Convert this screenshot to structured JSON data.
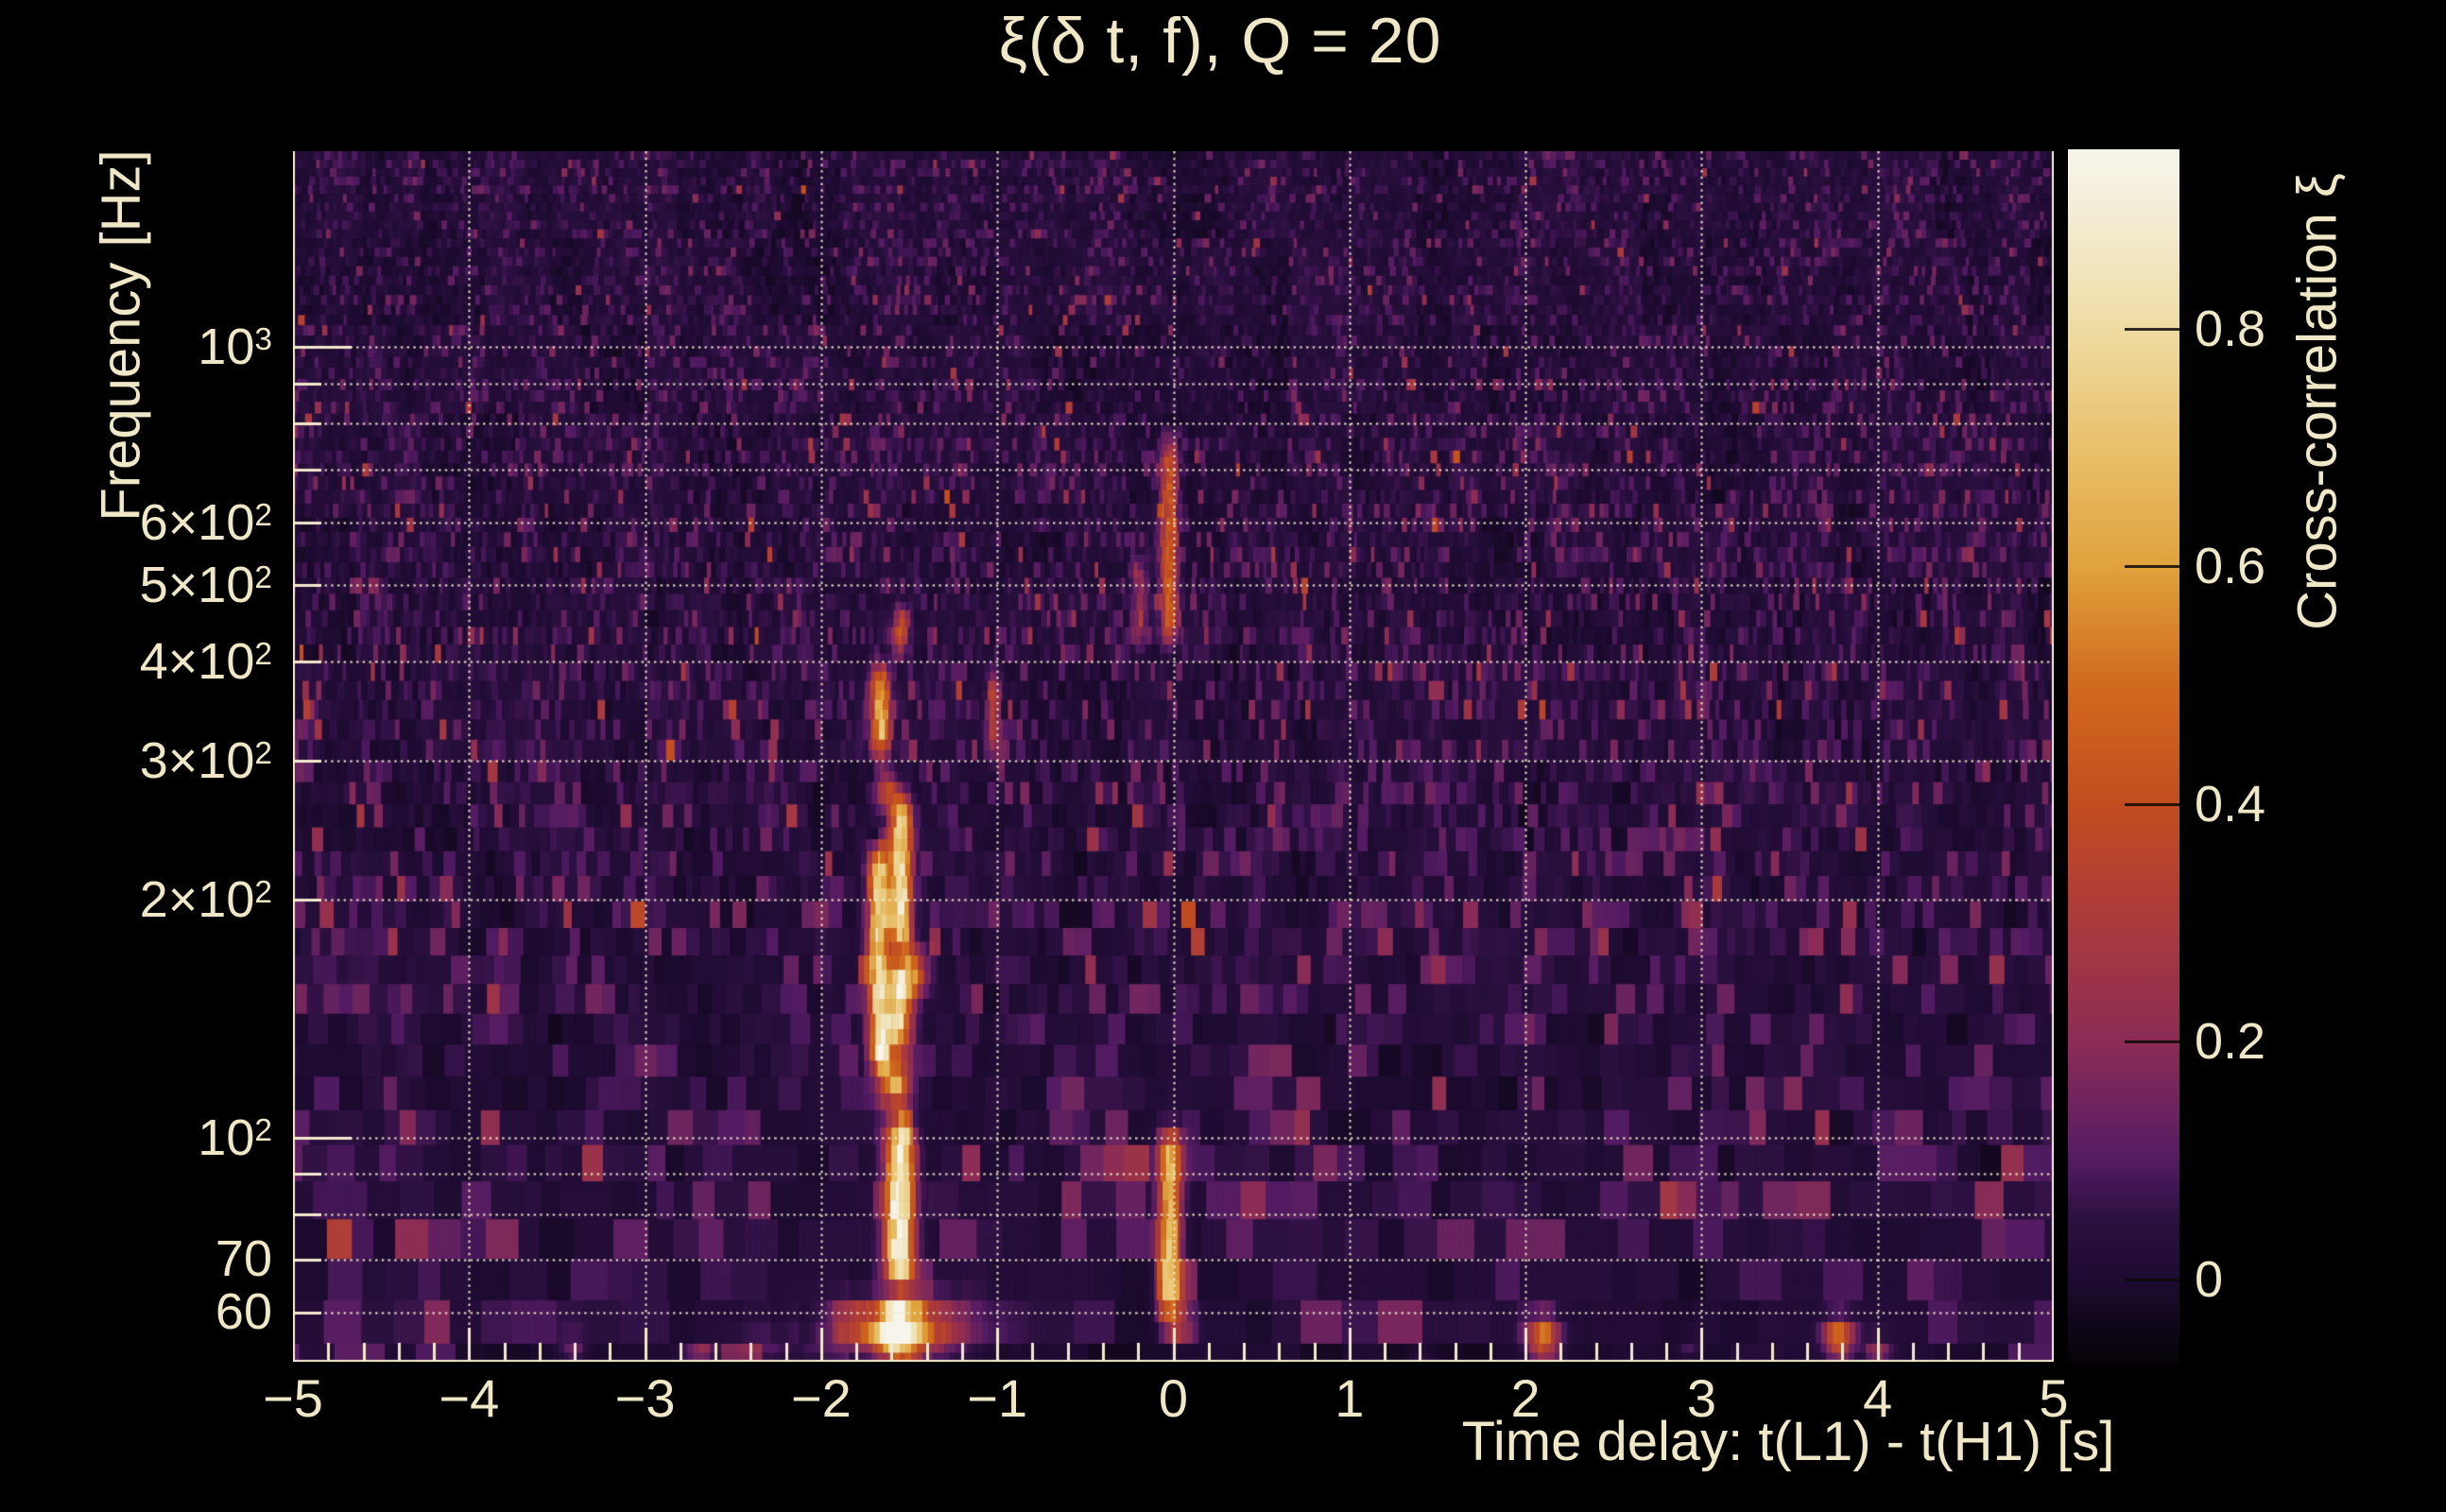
{
  "title": "ξ(δ t, f), Q = 20",
  "axes": {
    "x": {
      "title": "Time delay: t(L1) - t(H1) [s]"
    },
    "y": {
      "title": "Frequency [Hz]"
    },
    "colorbar": {
      "title": "Cross-correlation ξ"
    }
  },
  "chart_data": {
    "type": "heatmap",
    "description": "Q-transform style cross-correlation spectrogram: time delay between L1 and H1 on x (linear, -5 to 5 s), frequency on y (log, ~52 to ~1770 Hz), cross-correlation value as color. Dark purple noise background with a bright chirp-like track near dt = -1.55 s rising from ~52 Hz to ~480 Hz, fainter vertical features at dt = 0, and isolated hot spots along the bottom row.",
    "x_axis": {
      "label": "Time delay: t(L1) - t(H1) [s]",
      "min": -5,
      "max": 5,
      "major_ticks": [
        -5,
        -4,
        -3,
        -2,
        -1,
        0,
        1,
        2,
        3,
        4,
        5
      ],
      "tick_labels": [
        "−5",
        "−4",
        "−3",
        "−2",
        "−1",
        "0",
        "1",
        "2",
        "3",
        "4",
        "5"
      ],
      "minor_tick_step": 0.2,
      "gridlines": [
        -4,
        -3,
        -2,
        -1,
        0,
        1,
        2,
        3,
        4,
        5
      ],
      "grid_style": "dotted"
    },
    "y_axis": {
      "label": "Frequency [Hz]",
      "scale": "log",
      "min": 52,
      "max": 1770,
      "gridlines": [
        60,
        70,
        80,
        90,
        100,
        200,
        300,
        400,
        500,
        600,
        700,
        800,
        900,
        1000
      ],
      "labeled_ticks": [
        {
          "f": 1000,
          "mantissa": "10",
          "exponent": "3"
        },
        {
          "f": 600,
          "mantissa": "6×10",
          "exponent": "2"
        },
        {
          "f": 500,
          "mantissa": "5×10",
          "exponent": "2"
        },
        {
          "f": 400,
          "mantissa": "4×10",
          "exponent": "2"
        },
        {
          "f": 300,
          "mantissa": "3×10",
          "exponent": "2"
        },
        {
          "f": 200,
          "mantissa": "2×10",
          "exponent": "2"
        },
        {
          "f": 100,
          "mantissa": "10",
          "exponent": "2"
        },
        {
          "f": 70,
          "mantissa": "70",
          "exponent": ""
        },
        {
          "f": 60,
          "mantissa": "60",
          "exponent": ""
        }
      ]
    },
    "colorbar": {
      "label": "Cross-correlation ξ",
      "min": -0.071,
      "max": 0.951,
      "ticks": [
        {
          "v": 0.8,
          "label": "0.8"
        },
        {
          "v": 0.6,
          "label": "0.6"
        },
        {
          "v": 0.4,
          "label": "0.4"
        },
        {
          "v": 0.2,
          "label": "0.2"
        },
        {
          "v": 0.0,
          "label": "0"
        }
      ]
    },
    "colormap_stops": [
      [
        -0.071,
        "#050306"
      ],
      [
        0.0,
        "#1d0b31"
      ],
      [
        0.05,
        "#2b1040"
      ],
      [
        0.1,
        "#531b62"
      ],
      [
        0.15,
        "#70255e"
      ],
      [
        0.2,
        "#8c2c55"
      ],
      [
        0.3,
        "#aa3a3c"
      ],
      [
        0.4,
        "#c24d20"
      ],
      [
        0.5,
        "#d06a1c"
      ],
      [
        0.6,
        "#e0a23c"
      ],
      [
        0.7,
        "#e8c06a"
      ],
      [
        0.8,
        "#efdca3"
      ],
      [
        0.9,
        "#f4eed7"
      ],
      [
        0.951,
        "#f7f4ec"
      ]
    ],
    "background_noise": {
      "seed": 1337,
      "typical_value": 0.05,
      "hot_speckle_fraction": 0.006,
      "description": "mottled dark-purple vertical striations; finer/narrower tiles at high frequency, wide blocky tiles below ~100 Hz; sparse pink/red speckles up to ~0.35"
    },
    "features": {
      "chirp": [
        {
          "dt": -1.57,
          "f1": 51,
          "f2": 65,
          "w": 0.26,
          "v": 0.5
        },
        {
          "dt": -1.555,
          "f1": 51,
          "f2": 64,
          "w": 0.075,
          "v": 0.96
        },
        {
          "dt": -1.555,
          "f1": 63,
          "f2": 108,
          "w": 0.055,
          "v": 0.93
        },
        {
          "dt": -1.575,
          "f1": 104,
          "f2": 130,
          "w": 0.055,
          "v": 0.66
        },
        {
          "dt": -1.56,
          "f1": 124,
          "f2": 172,
          "w": 0.05,
          "v": 0.8
        },
        {
          "dt": -1.67,
          "f1": 116,
          "f2": 242,
          "w": 0.042,
          "v": 0.74
        },
        {
          "dt": -1.545,
          "f1": 166,
          "f2": 280,
          "w": 0.042,
          "v": 0.8
        },
        {
          "dt": -1.48,
          "f1": 146,
          "f2": 180,
          "w": 0.06,
          "v": 0.48
        },
        {
          "dt": -1.66,
          "f1": 292,
          "f2": 408,
          "w": 0.038,
          "v": 0.66
        },
        {
          "dt": -1.62,
          "f1": 252,
          "f2": 300,
          "w": 0.04,
          "v": 0.42
        },
        {
          "dt": -1.55,
          "f1": 392,
          "f2": 488,
          "w": 0.032,
          "v": 0.38
        }
      ],
      "zero_lag": [
        {
          "dt": -0.02,
          "f1": 408,
          "f2": 795,
          "w": 0.035,
          "v": 0.42
        },
        {
          "dt": -0.19,
          "f1": 400,
          "f2": 560,
          "w": 0.03,
          "v": 0.2
        },
        {
          "dt": -0.02,
          "f1": 56,
          "f2": 106,
          "w": 0.045,
          "v": 0.6
        },
        {
          "dt": 0.04,
          "f1": 54,
          "f2": 62,
          "w": 0.06,
          "v": 0.45
        }
      ],
      "other": [
        {
          "dt": -1.02,
          "f1": 288,
          "f2": 408,
          "w": 0.028,
          "v": 0.26
        }
      ],
      "bottom_row": [
        {
          "dt": -3.41,
          "f1": 51,
          "f2": 57,
          "w": 0.05,
          "v": 0.3
        },
        {
          "dt": -2.69,
          "f1": 51,
          "f2": 56.5,
          "w": 0.06,
          "v": 0.52
        },
        {
          "dt": -2.33,
          "f1": 51,
          "f2": 58,
          "w": 0.12,
          "v": 0.14
        },
        {
          "dt": 1.41,
          "f1": 51,
          "f2": 55,
          "w": 0.05,
          "v": 0.18
        },
        {
          "dt": 2.1,
          "f1": 51,
          "f2": 61,
          "w": 0.065,
          "v": 0.58
        },
        {
          "dt": 2.93,
          "f1": 52,
          "f2": 57,
          "w": 0.04,
          "v": 0.25
        },
        {
          "dt": 3.78,
          "f1": 51,
          "f2": 61,
          "w": 0.06,
          "v": 0.62
        },
        {
          "dt": 4.0,
          "f1": 51,
          "f2": 57,
          "w": 0.05,
          "v": 0.48
        }
      ]
    }
  }
}
